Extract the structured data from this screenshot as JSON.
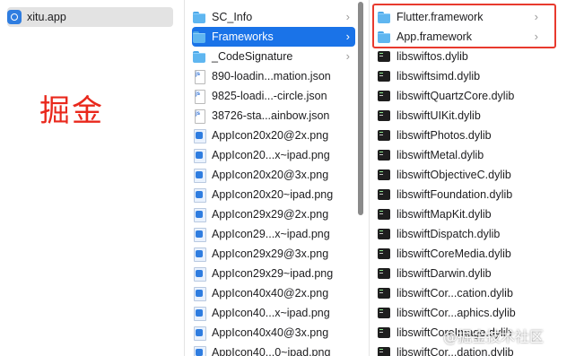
{
  "sidebar": {
    "selected_item": "xitu.app"
  },
  "overlay_label": "掘金",
  "column2": {
    "items": [
      {
        "name": "SC_Info",
        "kind": "folder",
        "has_children": true,
        "selected": false
      },
      {
        "name": "Frameworks",
        "kind": "folder",
        "has_children": true,
        "selected": true
      },
      {
        "name": "_CodeSignature",
        "kind": "folder",
        "has_children": true,
        "selected": false
      },
      {
        "name": "890-loadin...mation.json",
        "kind": "json"
      },
      {
        "name": "9825-loadi...-circle.json",
        "kind": "json"
      },
      {
        "name": "38726-sta...ainbow.json",
        "kind": "json"
      },
      {
        "name": "AppIcon20x20@2x.png",
        "kind": "png"
      },
      {
        "name": "AppIcon20...x~ipad.png",
        "kind": "png"
      },
      {
        "name": "AppIcon20x20@3x.png",
        "kind": "png"
      },
      {
        "name": "AppIcon20x20~ipad.png",
        "kind": "png"
      },
      {
        "name": "AppIcon29x29@2x.png",
        "kind": "png"
      },
      {
        "name": "AppIcon29...x~ipad.png",
        "kind": "png"
      },
      {
        "name": "AppIcon29x29@3x.png",
        "kind": "png"
      },
      {
        "name": "AppIcon29x29~ipad.png",
        "kind": "png"
      },
      {
        "name": "AppIcon40x40@2x.png",
        "kind": "png"
      },
      {
        "name": "AppIcon40...x~ipad.png",
        "kind": "png"
      },
      {
        "name": "AppIcon40x40@3x.png",
        "kind": "png"
      },
      {
        "name": "AppIcon40...0~ipad.png",
        "kind": "png"
      }
    ]
  },
  "column3": {
    "items": [
      {
        "name": "Flutter.framework",
        "kind": "folder",
        "has_children": true
      },
      {
        "name": "App.framework",
        "kind": "folder",
        "has_children": true
      },
      {
        "name": "libswiftos.dylib",
        "kind": "dylib"
      },
      {
        "name": "libswiftsimd.dylib",
        "kind": "dylib"
      },
      {
        "name": "libswiftQuartzCore.dylib",
        "kind": "dylib"
      },
      {
        "name": "libswiftUIKit.dylib",
        "kind": "dylib"
      },
      {
        "name": "libswiftPhotos.dylib",
        "kind": "dylib"
      },
      {
        "name": "libswiftMetal.dylib",
        "kind": "dylib"
      },
      {
        "name": "libswiftObjectiveC.dylib",
        "kind": "dylib"
      },
      {
        "name": "libswiftFoundation.dylib",
        "kind": "dylib"
      },
      {
        "name": "libswiftMapKit.dylib",
        "kind": "dylib"
      },
      {
        "name": "libswiftDispatch.dylib",
        "kind": "dylib"
      },
      {
        "name": "libswiftCoreMedia.dylib",
        "kind": "dylib"
      },
      {
        "name": "libswiftDarwin.dylib",
        "kind": "dylib"
      },
      {
        "name": "libswiftCor...cation.dylib",
        "kind": "dylib"
      },
      {
        "name": "libswiftCor...aphics.dylib",
        "kind": "dylib"
      },
      {
        "name": "libswiftCoreImage.dylib",
        "kind": "dylib"
      },
      {
        "name": "libswiftCor...dation.dylib",
        "kind": "dylib"
      }
    ]
  },
  "chevron_glyph": "›",
  "watermark": "@掘金技术社区",
  "colors": {
    "selection": "#1a73e8",
    "highlight_box": "#e83a2e",
    "overlay_text": "#e9281c"
  }
}
